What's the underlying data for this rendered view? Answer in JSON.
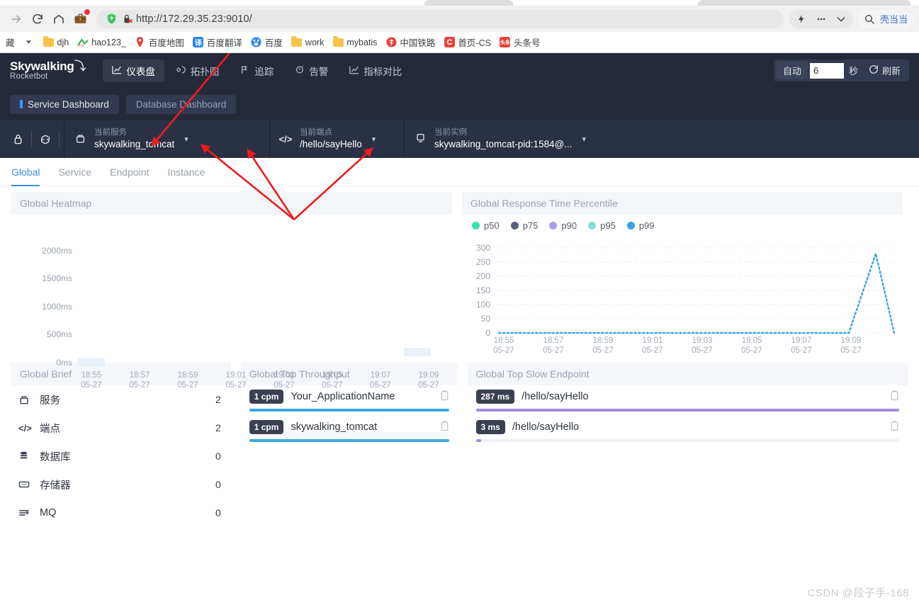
{
  "browser": {
    "toolbar_icons": [
      "forward-arrow",
      "reload",
      "home",
      "briefcase-extension",
      "shield-extension",
      "blocked-cookie"
    ],
    "url_display": "http://172.29.35.23:9010/",
    "url_scheme": "http://",
    "url_host": "172.29.35.23:9010",
    "url_path": "/",
    "right_icons": [
      "lightning",
      "more-options",
      "chevron-down"
    ],
    "search_label": "壳当当",
    "bookmarks": [
      {
        "label": "藏",
        "icon": "text-only"
      },
      {
        "label": "",
        "icon": "chevron-down"
      },
      {
        "label": "djh",
        "icon": "folder"
      },
      {
        "label": "hao123_",
        "icon": "hao123"
      },
      {
        "label": "百度地图",
        "icon": "map-pin"
      },
      {
        "label": "百度翻译",
        "icon": "translate"
      },
      {
        "label": "百度",
        "icon": "baidu-paw"
      },
      {
        "label": "work",
        "icon": "folder"
      },
      {
        "label": "mybatis",
        "icon": "folder"
      },
      {
        "label": "中国铁路",
        "icon": "railway"
      },
      {
        "label": "首页-CS",
        "icon": "csdn"
      },
      {
        "label": "头条号",
        "icon": "toutiao"
      }
    ]
  },
  "app": {
    "logo": {
      "line1": "Skywalking",
      "line2": "Rocketbot"
    },
    "nav": [
      {
        "label": "仪表盘",
        "icon": "chart-icon",
        "active": true
      },
      {
        "label": "拓扑图",
        "icon": "topology-icon",
        "active": false
      },
      {
        "label": "追踪",
        "icon": "trace-icon",
        "active": false
      },
      {
        "label": "告警",
        "icon": "alarm-icon",
        "active": false
      },
      {
        "label": "指标对比",
        "icon": "compare-icon",
        "active": false
      }
    ],
    "auto_refresh": {
      "auto_label": "自动",
      "seconds_value": "6",
      "seconds_unit": "秒",
      "refresh_label": "刷新",
      "refresh_icon": "refresh-icon"
    },
    "dashboard_tabs": [
      {
        "label": "Service Dashboard",
        "active": true
      },
      {
        "label": "Database Dashboard",
        "active": false
      }
    ],
    "selectors": {
      "tools": [
        "lock-icon",
        "sync-icon"
      ],
      "items": [
        {
          "icon": "service-icon",
          "label": "当前服务",
          "value": "skywalking_tomcat"
        },
        {
          "icon": "endpoint-icon",
          "label": "当前端点",
          "value": "/hello/sayHello"
        },
        {
          "icon": "instance-icon",
          "label": "当前实例",
          "value": "skywalking_tomcat-pid:1584@..."
        }
      ]
    },
    "subtabs": [
      {
        "label": "Global",
        "active": true
      },
      {
        "label": "Service",
        "active": false
      },
      {
        "label": "Endpoint",
        "active": false
      },
      {
        "label": "Instance",
        "active": false
      }
    ],
    "panels": {
      "heatmap_title": "Global Heatmap",
      "percentile_title": "Global Response Time Percentile",
      "brief_title": "Global Brief",
      "throughput_title": "Global Top Throughput",
      "slow_endpoint_title": "Global Top Slow Endpoint"
    },
    "brief": [
      {
        "icon": "service-icon",
        "name": "服务",
        "value": "2"
      },
      {
        "icon": "endpoint-icon",
        "name": "端点",
        "value": "2"
      },
      {
        "icon": "database-icon",
        "name": "数据库",
        "value": "0"
      },
      {
        "icon": "cache-icon",
        "name": "存储器",
        "value": "0"
      },
      {
        "icon": "mq-icon",
        "name": "MQ",
        "value": "0"
      }
    ],
    "top_throughput": [
      {
        "badge": "1 cpm",
        "name": "Your_ApplicationName",
        "bar_pct": 100,
        "bar_color": "#3aa8e0"
      },
      {
        "badge": "1 cpm",
        "name": "skywalking_tomcat",
        "bar_pct": 100,
        "bar_color": "#3aa8e0"
      }
    ],
    "top_slow_endpoint": [
      {
        "badge": "287 ms",
        "name": "/hello/sayHello",
        "bar_pct": 100,
        "bar_color": "#a48ae0"
      },
      {
        "badge": "3 ms",
        "name": "/hello/sayHello",
        "bar_pct": 1,
        "bar_color": "#a48ae0"
      }
    ],
    "watermark": "CSDN @段子手-168"
  },
  "chart_data": [
    {
      "type": "heatmap",
      "title": "Global Heatmap",
      "xlabel": "",
      "ylabel": "",
      "ytick_labels": [
        "2000ms",
        "1500ms",
        "1000ms",
        "500ms",
        "0ms"
      ],
      "ytick_values": [
        2000,
        1500,
        1000,
        500,
        0
      ],
      "ylim": [
        0,
        2000
      ],
      "xtick_labels": [
        "18:55\n05-27",
        "18:57\n05-27",
        "18:59\n05-27",
        "19:01\n05-27",
        "19:03\n05-27",
        "19:05\n05-27",
        "19:07\n05-27",
        "19:09\n05-27"
      ],
      "xtick_times": [
        "18:55",
        "18:57",
        "18:59",
        "19:01",
        "19:03",
        "19:05",
        "19:07",
        "19:09"
      ],
      "xtick_date": "05-27",
      "grid": false,
      "cells": [
        {
          "time": "18:55",
          "bucket_ms": 0,
          "value": 1,
          "color": "#e7f0fb"
        },
        {
          "time": "19:08",
          "bucket_ms": 120,
          "value": 1,
          "color": "#e7f0fb"
        }
      ]
    },
    {
      "type": "line",
      "title": "Global Response Time Percentile",
      "xlabel": "",
      "ylabel": "",
      "ylim": [
        0,
        300
      ],
      "ytick_labels": [
        "0",
        "50",
        "100",
        "150",
        "200",
        "250",
        "300"
      ],
      "ytick_values": [
        0,
        50,
        100,
        150,
        200,
        250,
        300
      ],
      "xtick_labels": [
        "18:55",
        "18:57",
        "18:59",
        "19:01",
        "19:03",
        "19:05",
        "19:07",
        "19:09"
      ],
      "xtick_date": "05-27",
      "grid": true,
      "legend_position": "top-left",
      "legend": [
        {
          "name": "p50",
          "color": "#3ee0b0"
        },
        {
          "name": "p75",
          "color": "#5b6184"
        },
        {
          "name": "p90",
          "color": "#a8a2e8"
        },
        {
          "name": "p95",
          "color": "#85ddd8"
        },
        {
          "name": "p99",
          "color": "#3ba1e8"
        }
      ],
      "series": [
        {
          "name": "p99",
          "color": "#3ba1e8",
          "x": [
            "18:55",
            "18:56",
            "18:57",
            "18:58",
            "18:59",
            "19:00",
            "19:01",
            "19:02",
            "19:03",
            "19:04",
            "19:05",
            "19:06",
            "19:07",
            "19:08",
            "19:09",
            "19:10"
          ],
          "values": [
            0,
            0,
            0,
            0,
            0,
            0,
            0,
            0,
            0,
            0,
            0,
            0,
            0,
            0,
            280,
            0
          ]
        },
        {
          "name": "p50",
          "color": "#3ee0b0",
          "x": [
            "18:55",
            "18:56",
            "18:57",
            "18:58",
            "18:59",
            "19:00",
            "19:01",
            "19:02",
            "19:03",
            "19:04",
            "19:05",
            "19:06",
            "19:07",
            "19:08",
            "19:09",
            "19:10"
          ],
          "values": [
            0,
            0,
            0,
            0,
            0,
            0,
            0,
            0,
            0,
            0,
            0,
            0,
            0,
            0,
            0,
            0
          ]
        },
        {
          "name": "p75",
          "color": "#5b6184",
          "x": [
            "18:55",
            "18:56",
            "18:57",
            "18:58",
            "18:59",
            "19:00",
            "19:01",
            "19:02",
            "19:03",
            "19:04",
            "19:05",
            "19:06",
            "19:07",
            "19:08",
            "19:09",
            "19:10"
          ],
          "values": [
            0,
            0,
            0,
            0,
            0,
            0,
            0,
            0,
            0,
            0,
            0,
            0,
            0,
            0,
            0,
            0
          ]
        },
        {
          "name": "p90",
          "color": "#a8a2e8",
          "x": [
            "18:55",
            "18:56",
            "18:57",
            "18:58",
            "18:59",
            "19:00",
            "19:01",
            "19:02",
            "19:03",
            "19:04",
            "19:05",
            "19:06",
            "19:07",
            "19:08",
            "19:09",
            "19:10"
          ],
          "values": [
            0,
            0,
            0,
            0,
            0,
            0,
            0,
            0,
            0,
            0,
            0,
            0,
            0,
            0,
            0,
            0
          ]
        },
        {
          "name": "p95",
          "color": "#85ddd8",
          "x": [
            "18:55",
            "18:56",
            "18:57",
            "18:58",
            "18:59",
            "19:00",
            "19:01",
            "19:02",
            "19:03",
            "19:04",
            "19:05",
            "19:06",
            "19:07",
            "19:08",
            "19:09",
            "19:10"
          ],
          "values": [
            0,
            0,
            0,
            0,
            0,
            0,
            0,
            0,
            0,
            0,
            0,
            0,
            0,
            0,
            0,
            0
          ]
        }
      ]
    },
    {
      "type": "bar",
      "title": "Global Top Throughput",
      "categories": [
        "Your_ApplicationName",
        "skywalking_tomcat"
      ],
      "values": [
        1,
        1
      ],
      "unit": "cpm",
      "xlabel": "",
      "ylabel": ""
    },
    {
      "type": "bar",
      "title": "Global Top Slow Endpoint",
      "categories": [
        "/hello/sayHello",
        "/hello/sayHello"
      ],
      "values": [
        287,
        3
      ],
      "unit": "ms",
      "xlabel": "",
      "ylabel": ""
    },
    {
      "type": "table",
      "title": "Global Brief",
      "categories": [
        "服务",
        "端点",
        "数据库",
        "存储器",
        "MQ"
      ],
      "values": [
        2,
        2,
        0,
        0,
        0
      ]
    }
  ]
}
